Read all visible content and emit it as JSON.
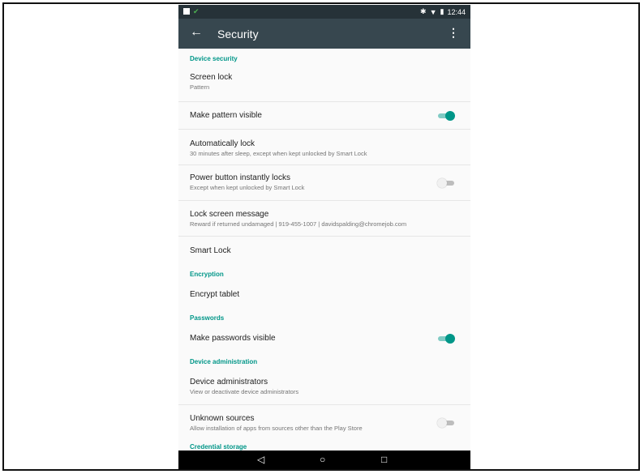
{
  "status": {
    "time": "12:44",
    "icons": [
      "bluetooth-icon",
      "wifi-icon",
      "battery-icon"
    ]
  },
  "appbar": {
    "title": "Security",
    "back_icon": "arrow-back-icon",
    "more_icon": "more-vert-icon"
  },
  "colors": {
    "accent": "#009688",
    "appbar": "#37474f",
    "statusbar": "#263238"
  },
  "sections": {
    "device_security": "Device security",
    "encryption": "Encryption",
    "passwords": "Passwords",
    "device_admin": "Device administration",
    "credential_storage": "Credential storage"
  },
  "items": {
    "screen_lock": {
      "title": "Screen lock",
      "summary": "Pattern"
    },
    "pattern_visible": {
      "title": "Make pattern visible",
      "checked": true
    },
    "auto_lock": {
      "title": "Automatically lock",
      "summary": "30 minutes after sleep, except when kept unlocked by Smart Lock"
    },
    "power_lock": {
      "title": "Power button instantly locks",
      "summary": "Except when kept unlocked by Smart Lock",
      "checked": false
    },
    "lock_message": {
      "title": "Lock screen message",
      "summary": "Reward if returned undamaged | 919-455-1007 | davidspalding@chromejob.com"
    },
    "smart_lock": {
      "title": "Smart Lock"
    },
    "encrypt": {
      "title": "Encrypt tablet"
    },
    "passwords_visible": {
      "title": "Make passwords visible",
      "checked": true
    },
    "device_admins": {
      "title": "Device administrators",
      "summary": "View or deactivate device administrators"
    },
    "unknown_sources": {
      "title": "Unknown sources",
      "summary": "Allow installation of apps from sources other than the Play Store",
      "checked": false
    }
  },
  "navbar": {
    "back": "◁",
    "home": "○",
    "recents": "□"
  }
}
